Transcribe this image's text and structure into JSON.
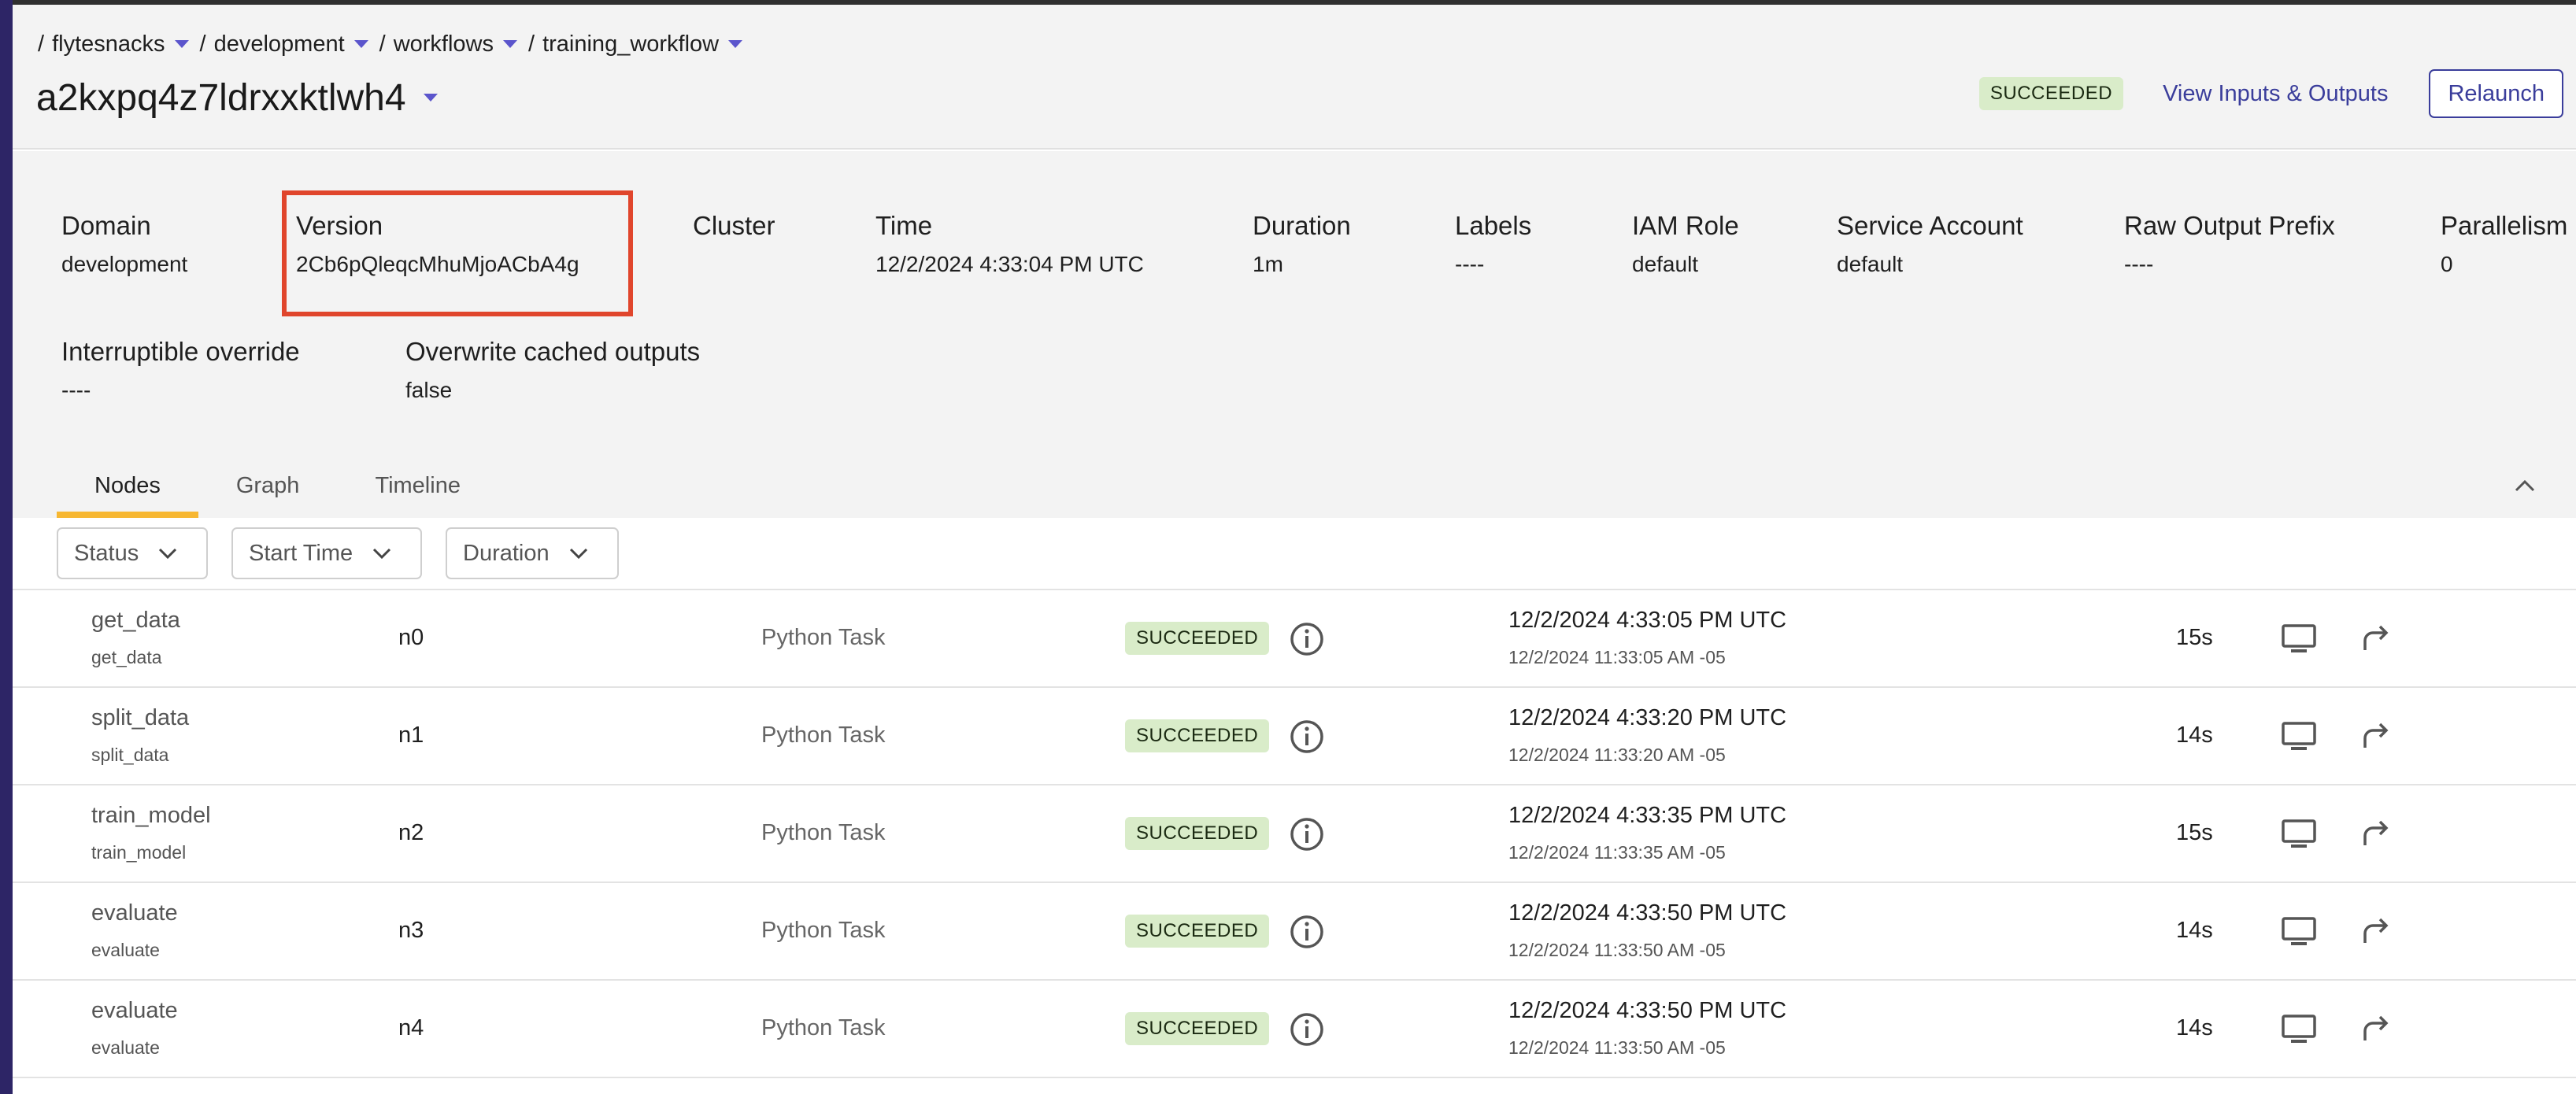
{
  "breadcrumb": [
    {
      "label": "flytesnacks"
    },
    {
      "label": "development"
    },
    {
      "label": "workflows"
    },
    {
      "label": "training_workflow"
    }
  ],
  "separator": "/",
  "execution": {
    "name": "a2kxpq4z7ldrxxktlwh4",
    "status": "SUCCEEDED",
    "view_io_label": "View Inputs & Outputs",
    "relaunch_label": "Relaunch"
  },
  "metadata": {
    "domain": {
      "label": "Domain",
      "value": "development"
    },
    "version": {
      "label": "Version",
      "value": "2Cb6pQleqcMhuMjoACbA4g"
    },
    "cluster": {
      "label": "Cluster",
      "value": ""
    },
    "time": {
      "label": "Time",
      "value": "12/2/2024 4:33:04 PM UTC"
    },
    "duration": {
      "label": "Duration",
      "value": "1m"
    },
    "labels": {
      "label": "Labels",
      "value": "----"
    },
    "iam_role": {
      "label": "IAM Role",
      "value": "default"
    },
    "service_account": {
      "label": "Service Account",
      "value": "default"
    },
    "raw_output_prefix": {
      "label": "Raw Output Prefix",
      "value": "----"
    },
    "parallelism": {
      "label": "Parallelism",
      "value": "0"
    },
    "interruptible": {
      "label": "Interruptible override",
      "value": "----"
    },
    "overwrite_cache": {
      "label": "Overwrite cached outputs",
      "value": "false"
    }
  },
  "tabs": [
    {
      "label": "Nodes",
      "active": true
    },
    {
      "label": "Graph",
      "active": false
    },
    {
      "label": "Timeline",
      "active": false
    }
  ],
  "filters": [
    {
      "label": "Status"
    },
    {
      "label": "Start Time"
    },
    {
      "label": "Duration"
    }
  ],
  "nodes": [
    {
      "name": "get_data",
      "sub": "get_data",
      "id": "n0",
      "type": "Python Task",
      "status": "SUCCEEDED",
      "start_utc": "12/2/2024 4:33:05 PM UTC",
      "start_local": "12/2/2024 11:33:05 AM -05",
      "duration": "15s"
    },
    {
      "name": "split_data",
      "sub": "split_data",
      "id": "n1",
      "type": "Python Task",
      "status": "SUCCEEDED",
      "start_utc": "12/2/2024 4:33:20 PM UTC",
      "start_local": "12/2/2024 11:33:20 AM -05",
      "duration": "14s"
    },
    {
      "name": "train_model",
      "sub": "train_model",
      "id": "n2",
      "type": "Python Task",
      "status": "SUCCEEDED",
      "start_utc": "12/2/2024 4:33:35 PM UTC",
      "start_local": "12/2/2024 11:33:35 AM -05",
      "duration": "15s"
    },
    {
      "name": "evaluate",
      "sub": "evaluate",
      "id": "n3",
      "type": "Python Task",
      "status": "SUCCEEDED",
      "start_utc": "12/2/2024 4:33:50 PM UTC",
      "start_local": "12/2/2024 11:33:50 AM -05",
      "duration": "14s"
    },
    {
      "name": "evaluate",
      "sub": "evaluate",
      "id": "n4",
      "type": "Python Task",
      "status": "SUCCEEDED",
      "start_utc": "12/2/2024 4:33:50 PM UTC",
      "start_local": "12/2/2024 11:33:50 AM -05",
      "duration": "14s"
    }
  ],
  "colors": {
    "accent": "#3a3d9b",
    "success_bg": "#d9ecc9",
    "tab_indicator": "#f7b731",
    "highlight": "#e0452c"
  }
}
